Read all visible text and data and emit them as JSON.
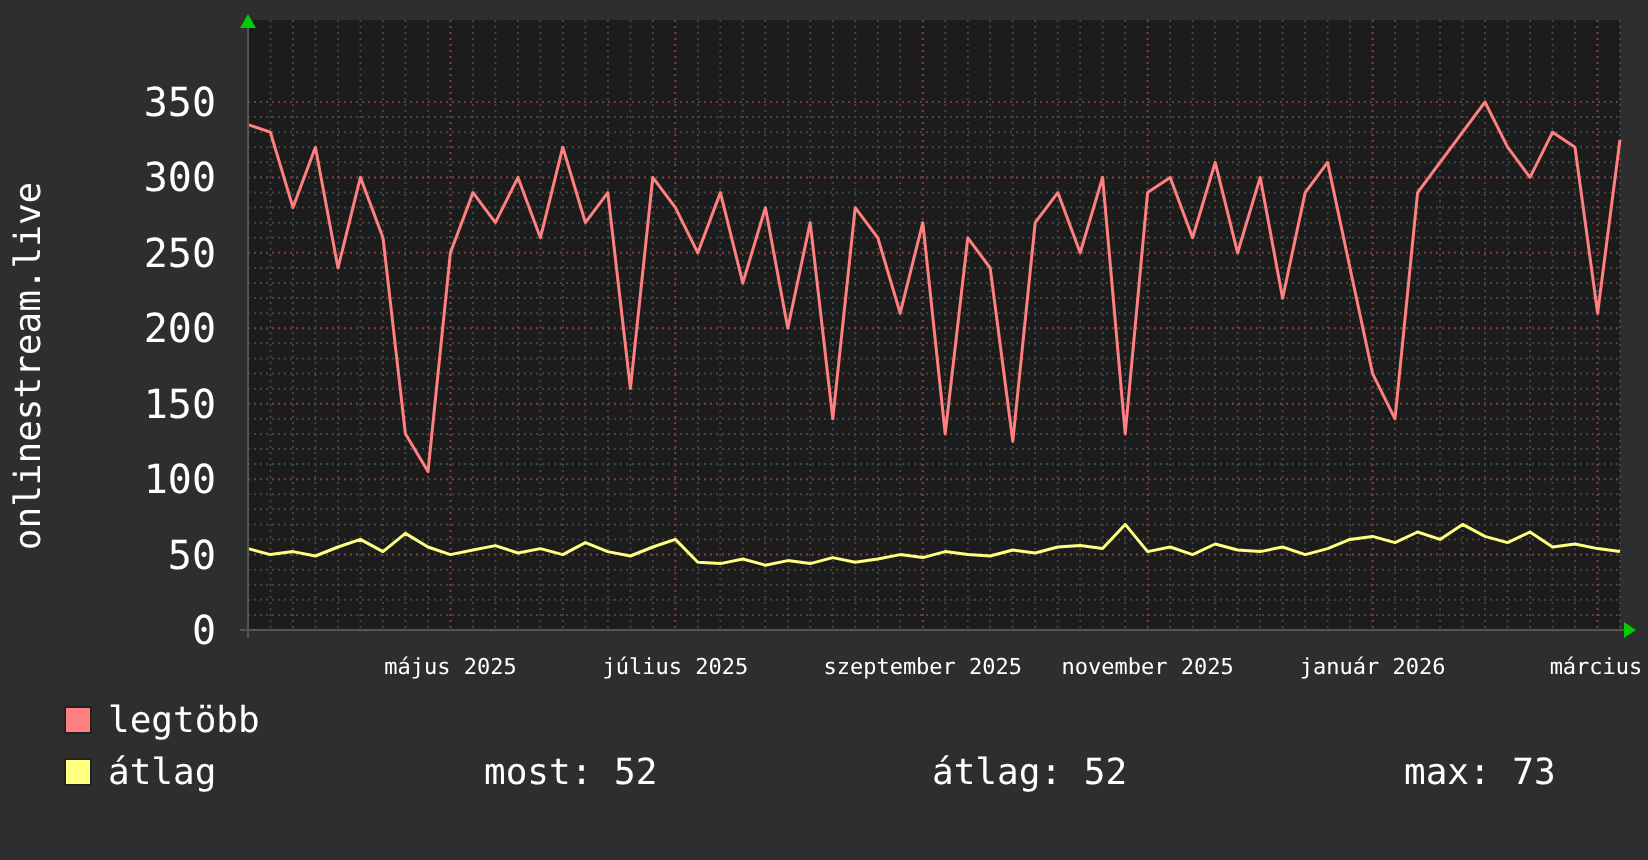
{
  "chart_data": {
    "type": "line",
    "ylabel": "onlinestream.live",
    "categories": [
      null,
      null,
      null,
      null,
      null,
      null,
      null,
      null,
      null,
      "május 2025",
      null,
      null,
      null,
      null,
      null,
      null,
      null,
      null,
      null,
      "július 2025",
      null,
      null,
      null,
      null,
      null,
      null,
      null,
      null,
      null,
      null,
      "szeptember 2025",
      null,
      null,
      null,
      null,
      null,
      null,
      null,
      null,
      null,
      "november 2025",
      null,
      null,
      null,
      null,
      null,
      null,
      null,
      null,
      null,
      "január 2026",
      null,
      null,
      null,
      null,
      null,
      null,
      null,
      null,
      null,
      "március",
      null
    ],
    "ylim": [
      0,
      350
    ],
    "grid": true,
    "yticks": [
      0,
      50,
      100,
      150,
      200,
      250,
      300,
      350
    ],
    "series": [
      {
        "name": "legtöbb",
        "color": "#ff8080",
        "values": [
          335,
          330,
          280,
          320,
          240,
          300,
          260,
          130,
          105,
          250,
          290,
          270,
          300,
          260,
          320,
          270,
          290,
          160,
          300,
          280,
          250,
          290,
          230,
          280,
          200,
          270,
          140,
          280,
          260,
          210,
          270,
          130,
          260,
          240,
          125,
          270,
          290,
          250,
          300,
          130,
          290,
          300,
          260,
          310,
          250,
          300,
          220,
          290,
          310,
          240,
          170,
          140,
          290,
          310,
          330,
          350,
          320,
          300,
          330,
          320,
          210,
          325
        ]
      },
      {
        "name": "átlag",
        "color": "#ffff80",
        "values": [
          54,
          50,
          52,
          49,
          55,
          60,
          52,
          64,
          55,
          50,
          53,
          56,
          51,
          54,
          50,
          58,
          52,
          49,
          55,
          60,
          45,
          44,
          47,
          43,
          46,
          44,
          48,
          45,
          47,
          50,
          48,
          52,
          50,
          49,
          53,
          51,
          55,
          56,
          54,
          70,
          52,
          55,
          50,
          57,
          53,
          52,
          55,
          50,
          54,
          60,
          62,
          58,
          65,
          60,
          70,
          62,
          58,
          65,
          55,
          57,
          54,
          52
        ]
      }
    ]
  },
  "legend_stats": [
    "most: 52",
    "átlag: 52",
    "max: 73"
  ]
}
